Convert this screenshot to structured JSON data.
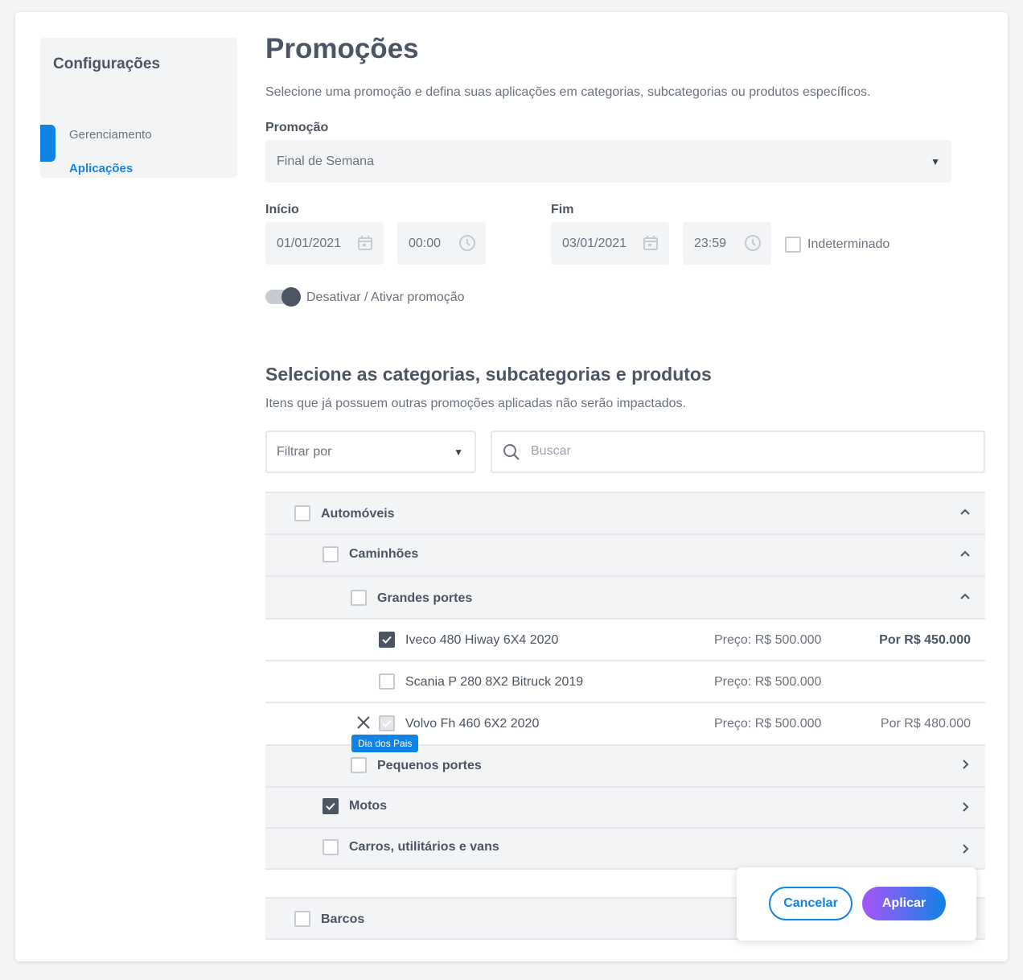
{
  "sidebar": {
    "title": "Configurações",
    "items": [
      {
        "label": "Gerenciamento",
        "active": false
      },
      {
        "label": "Aplicações",
        "active": true
      }
    ]
  },
  "header": {
    "title": "Promoções",
    "subtitle": "Selecione uma promoção e defina suas aplicações em categorias, subcategorias ou produtos específicos."
  },
  "promo": {
    "label": "Promoção",
    "selected": "Final de Semana"
  },
  "start": {
    "label": "Início",
    "date": "01/01/2021",
    "time": "00:00"
  },
  "end": {
    "label": "Fim",
    "date": "03/01/2021",
    "time": "23:59",
    "indeterminate_label": "Indeterminado",
    "indeterminate": false
  },
  "toggle": {
    "label": "Desativar / Ativar promoção",
    "on": true
  },
  "section": {
    "title": "Selecione as categorias, subcategorias e produtos",
    "subtitle": "Itens que já possuem outras promoções aplicadas não serão impactados."
  },
  "filter": {
    "placeholder": "Filtrar por"
  },
  "search": {
    "placeholder": "Buscar"
  },
  "tree": {
    "automoveis": "Automóveis",
    "caminhoes": "Caminhões",
    "grandes": "Grandes portes",
    "products": [
      {
        "name": "Iveco 480 Hiway 6X4 2020",
        "price": "Preço: R$ 500.000",
        "new_price": "Por R$ 450.000",
        "checked": true
      },
      {
        "name": "Scania P 280 8X2 Bitruck 2019",
        "price": "Preço: R$ 500.000",
        "new_price": "",
        "checked": false
      },
      {
        "name": "Volvo Fh 460 6X2 2020",
        "price": "Preço: R$ 500.000",
        "new_price": "Por R$ 480.000",
        "checked": true,
        "tag": "Dia dos Pais"
      }
    ],
    "pequenos": "Pequenos portes",
    "motos": "Motos",
    "carros": "Carros, utilitários e vans",
    "barcos": "Barcos"
  },
  "actions": {
    "cancel": "Cancelar",
    "apply": "Aplicar"
  },
  "colors": {
    "accent": "#1083e6",
    "gradient_start": "#a855f7",
    "text": "#4b5563"
  }
}
